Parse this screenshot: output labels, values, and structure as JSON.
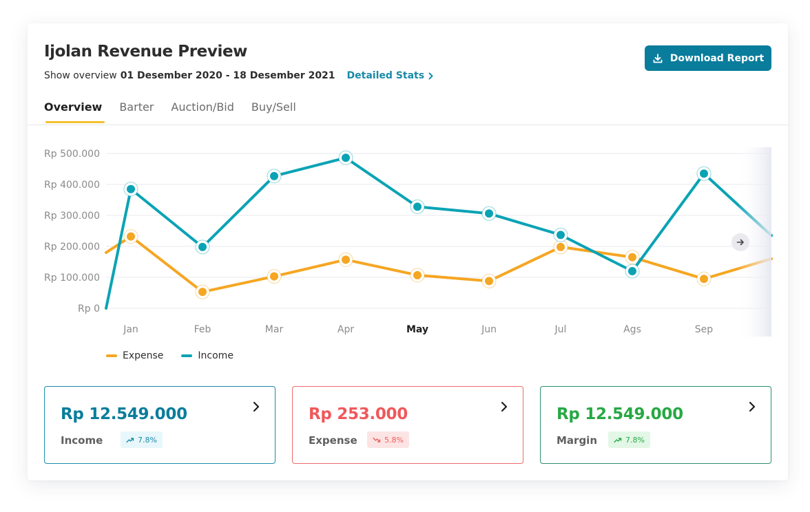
{
  "header": {
    "title": "Ijolan Revenue Preview",
    "subtitle_prefix": "Show overview",
    "date_range": "01 Desember 2020 - 18 Desember 2021",
    "detail_link": "Detailed Stats",
    "download_label": "Download Report"
  },
  "tabs": [
    {
      "label": "Overview",
      "active": true
    },
    {
      "label": "Barter",
      "active": false
    },
    {
      "label": "Auction/Bid",
      "active": false
    },
    {
      "label": "Buy/Sell",
      "active": false
    }
  ],
  "chart_data": {
    "type": "line",
    "categories": [
      "Jan",
      "Feb",
      "Mar",
      "Apr",
      "May",
      "Jun",
      "Jul",
      "Ags",
      "Sep"
    ],
    "highlighted_category": "May",
    "y_ticks": [
      "Rp 0",
      "Rp 100.000",
      "Rp 200.000",
      "Rp 300.000",
      "Rp 400.000",
      "Rp 500.000"
    ],
    "ylim": [
      0,
      500000
    ],
    "grid": true,
    "series": [
      {
        "name": "Expense",
        "color": "#f5a623",
        "start_value": 180000,
        "values": [
          232000,
          53000,
          103000,
          157000,
          107000,
          88000,
          198000,
          165000,
          95000
        ],
        "end_value": 160000
      },
      {
        "name": "Income",
        "color": "#0aa3b5",
        "start_value": 0,
        "values": [
          385000,
          198000,
          427000,
          486000,
          328000,
          306000,
          237000,
          120000,
          435000
        ],
        "end_value": 235000
      }
    ],
    "legend_position": "bottom-left"
  },
  "stats": [
    {
      "value": "Rp 12.549.000",
      "label": "Income",
      "change": "7.8%",
      "trend": "up",
      "color": "#0a7d9c",
      "border": "#1a8aa8",
      "badge_bg": "#e8f7fb",
      "badge_color": "#1a8aa8"
    },
    {
      "value": "Rp 253.000",
      "label": "Expense",
      "change": "5.8%",
      "trend": "down",
      "color": "#f0585b",
      "border": "#ee6a6a",
      "badge_bg": "#fde4e4",
      "badge_color": "#ee5d5d"
    },
    {
      "value": "Rp 12.549.000",
      "label": "Margin",
      "change": "7.8%",
      "trend": "up",
      "color": "#27a844",
      "border": "#2a8f6a",
      "badge_bg": "#e3f7e6",
      "badge_color": "#27a844"
    }
  ]
}
